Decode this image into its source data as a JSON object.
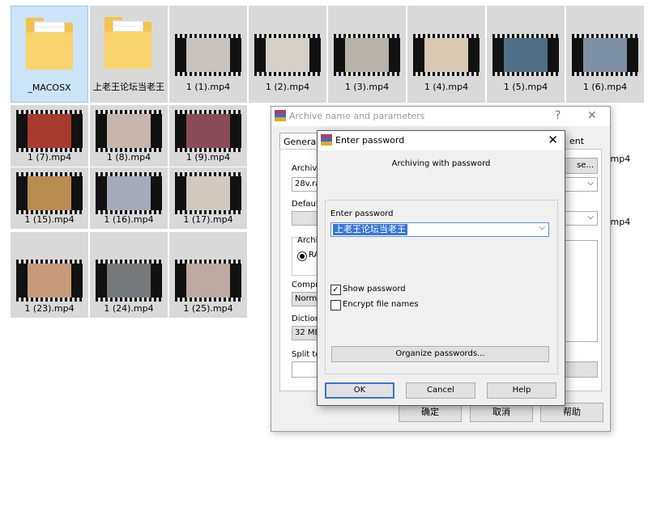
{
  "files": [
    {
      "name": "_MACOSX",
      "type": "folder",
      "selected": true
    },
    {
      "name": "上老王论坛当老王",
      "type": "folder"
    },
    {
      "name": "1 (1).mp4",
      "type": "video",
      "thumb": "#c9c2bd"
    },
    {
      "name": "1 (2).mp4",
      "type": "video",
      "thumb": "#d6cfc8"
    },
    {
      "name": "1 (3).mp4",
      "type": "video",
      "thumb": "#b9b2a8"
    },
    {
      "name": "1 (4).mp4",
      "type": "video",
      "thumb": "#d8c9b2"
    },
    {
      "name": "1 (5).mp4",
      "type": "video",
      "thumb": "#4f6f86"
    },
    {
      "name": "1 (6).mp4",
      "type": "video",
      "thumb": "#7c8fa3"
    },
    {
      "name": "1 (7).mp4",
      "type": "video",
      "thumb": "#a83a2e"
    },
    {
      "name": "1 (8).mp4",
      "type": "video",
      "thumb": "#c7b6ab"
    },
    {
      "name": "1 (9).mp4",
      "type": "video",
      "thumb": "#8a4b58"
    },
    {
      "name": "1 (15).mp4",
      "type": "video",
      "thumb": "#b98c52"
    },
    {
      "name": "1 (16).mp4",
      "type": "video",
      "thumb": "#a6a9b8"
    },
    {
      "name": "1 (17).mp4",
      "type": "video",
      "thumb": "#d1c8be"
    },
    {
      "name": "1 (23).mp4",
      "type": "video",
      "thumb": "#c79a7a"
    },
    {
      "name": "1 (24).mp4",
      "type": "video",
      "thumb": "#777a7c"
    },
    {
      "name": "1 (25).mp4",
      "type": "video",
      "thumb": "#bba9a2"
    }
  ],
  "partial_labels": [
    ".mp4",
    ".mp4"
  ],
  "archive_dialog": {
    "title": "Archive name and parameters",
    "help_glyph": "?",
    "close_glyph": "✕",
    "tab_general": "General",
    "tab_comment_partial": "ent",
    "archive_label": "Archive",
    "archive_value": "28v.ra",
    "browse_label": "se...",
    "default_label": "Default",
    "archive_format_label": "Archiv",
    "format_rar": "RA",
    "compression_label": "Compre",
    "compression_value": "Norma",
    "dictionary_label": "Dictiona",
    "dictionary_value": "32 MB",
    "split_label": "Split to",
    "ok_label": "确定",
    "cancel_label": "取消",
    "help_label": "帮助"
  },
  "password_dialog": {
    "title": "Enter password",
    "close_glyph": "✕",
    "subtitle": "Archiving with password",
    "enter_label": "Enter password",
    "password_value": "上老王论坛当老王",
    "show_password_label": "Show password",
    "show_password_checked": true,
    "encrypt_names_label": "Encrypt file names",
    "encrypt_names_checked": false,
    "organize_label": "Organize passwords...",
    "ok_label": "OK",
    "cancel_label": "Cancel",
    "help_label": "Help"
  }
}
